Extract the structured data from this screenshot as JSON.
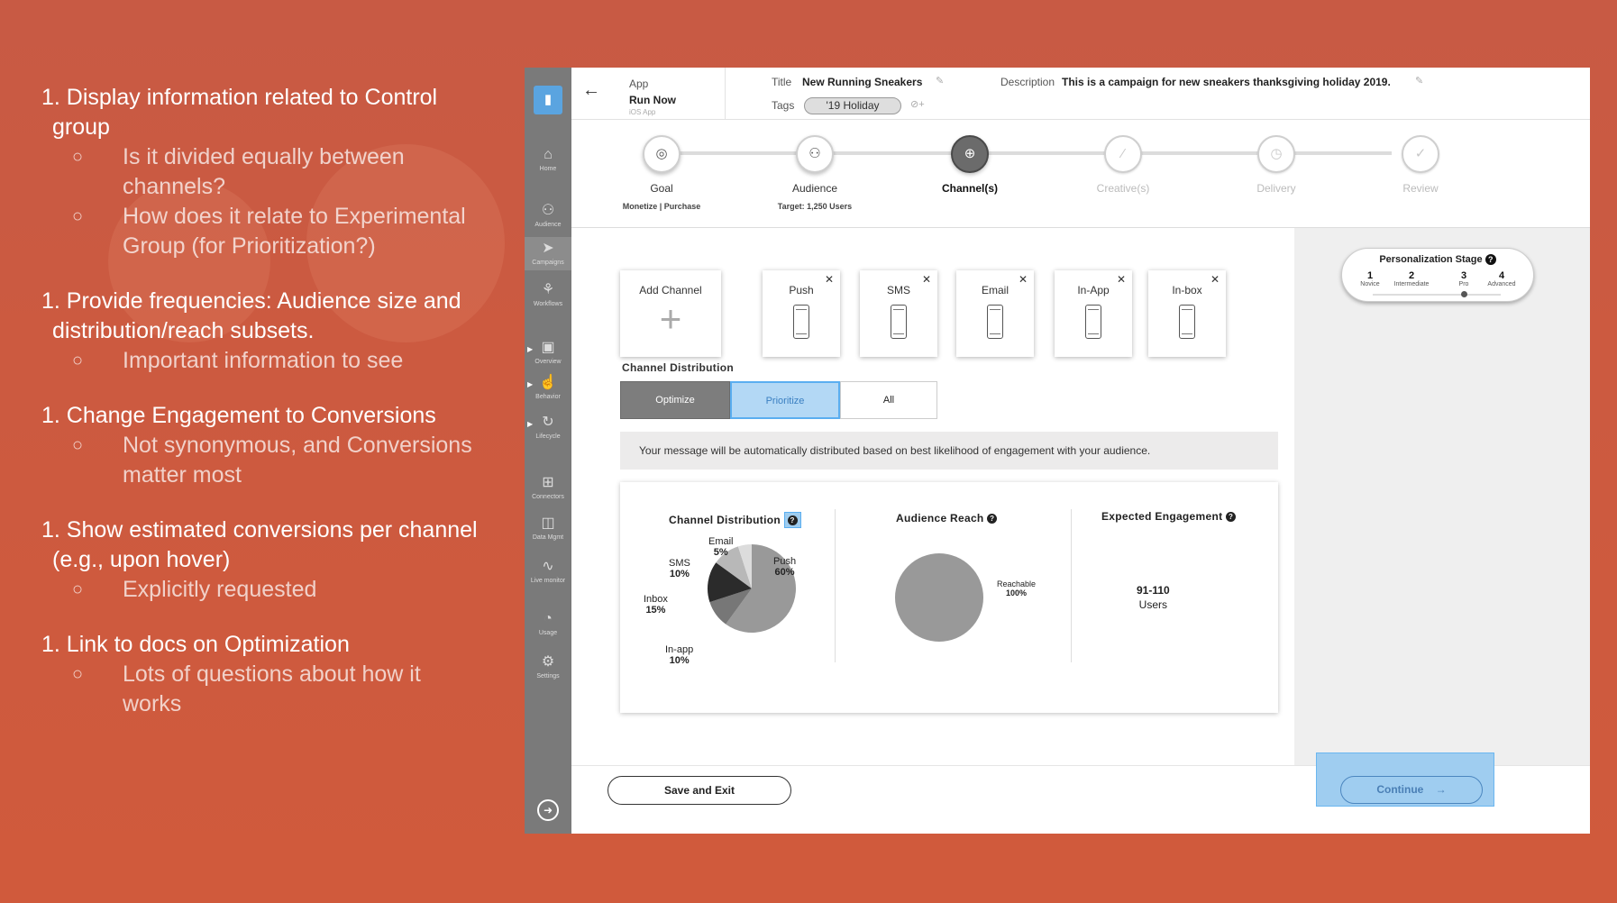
{
  "notes": [
    {
      "head": "1. Display information related to Control group",
      "subs": [
        "Is it divided equally between channels?",
        "How does it relate to Experimental Group (for Prioritization?)"
      ]
    },
    {
      "head": "1. Provide frequencies: Audience size and distribution/reach subsets.",
      "subs": [
        "Important information to see"
      ]
    },
    {
      "head": "1. Change Engagement to Conversions",
      "subs": [
        "Not synonymous, and Conversions matter most"
      ]
    },
    {
      "head": "1. Show estimated conversions per channel (e.g., upon hover)",
      "subs": [
        "Explicitly requested"
      ]
    },
    {
      "head": "1. Link to docs on Optimization",
      "subs": [
        "Lots of questions about how it works"
      ]
    }
  ],
  "sidebar": {
    "items": [
      "Home",
      "Audience",
      "Campaigns",
      "Workflows",
      "Overview",
      "Behavior",
      "Lifecycle",
      "Connectors",
      "Data Mgmt",
      "Live monitor",
      "Usage",
      "Settings"
    ]
  },
  "topbar": {
    "app_label": "App",
    "app_name": "Run Now",
    "app_platform": "iOS App",
    "title_label": "Title",
    "title_value": "New Running Sneakers",
    "tags_label": "Tags",
    "tag": "'19 Holiday",
    "desc_label": "Description",
    "desc_value": "This is a campaign for new sneakers thanksgiving holiday 2019."
  },
  "steps": [
    {
      "name": "Goal",
      "sub": "Monetize | Purchase"
    },
    {
      "name": "Audience",
      "sub": "Target: 1,250 Users"
    },
    {
      "name": "Channel(s)",
      "sub": ""
    },
    {
      "name": "Creative(s)",
      "sub": ""
    },
    {
      "name": "Delivery",
      "sub": ""
    },
    {
      "name": "Review",
      "sub": ""
    }
  ],
  "channels": {
    "add_label": "Add Channel",
    "cards": [
      "Push",
      "SMS",
      "Email",
      "In-App",
      "In-box"
    ]
  },
  "distribution": {
    "title": "Channel Distribution",
    "options": [
      "Optimize",
      "Prioritize",
      "All"
    ],
    "selected": "Prioritize",
    "info": "Your message will be automatically distributed based on best likelihood of engagement with your audience."
  },
  "personalization": {
    "title": "Personalization Stage",
    "stages": [
      {
        "n": "1",
        "t": "Novice"
      },
      {
        "n": "2",
        "t": "Intermediate"
      },
      {
        "n": "3",
        "t": "Pro"
      },
      {
        "n": "4",
        "t": "Advanced"
      }
    ],
    "current": 3
  },
  "chart_data": [
    {
      "type": "pie",
      "title": "Channel  Distribution",
      "slices": [
        {
          "label": "Push",
          "value": 60,
          "color": "#999999"
        },
        {
          "label": "In-app",
          "value": 10,
          "color": "#777777"
        },
        {
          "label": "Inbox",
          "value": 15,
          "color": "#2b2b2b"
        },
        {
          "label": "SMS",
          "value": 10,
          "color": "#b8b8b8"
        },
        {
          "label": "Email",
          "value": 5,
          "color": "#dcdcdc"
        }
      ],
      "display": {
        "Push": "60%",
        "In-app": "10%",
        "Inbox": "15%",
        "SMS": "10%",
        "Email": "5%"
      }
    },
    {
      "type": "pie",
      "title": "Audience Reach",
      "slices": [
        {
          "label": "Reachable",
          "value": 100,
          "color": "#999999"
        }
      ],
      "display": {
        "Reachable": "100%"
      }
    }
  ],
  "engagement": {
    "title": "Expected Engagement",
    "value": "91-110",
    "unit": "Users"
  },
  "footer": {
    "save_label": "Save and Exit",
    "continue_label": "Continue"
  }
}
